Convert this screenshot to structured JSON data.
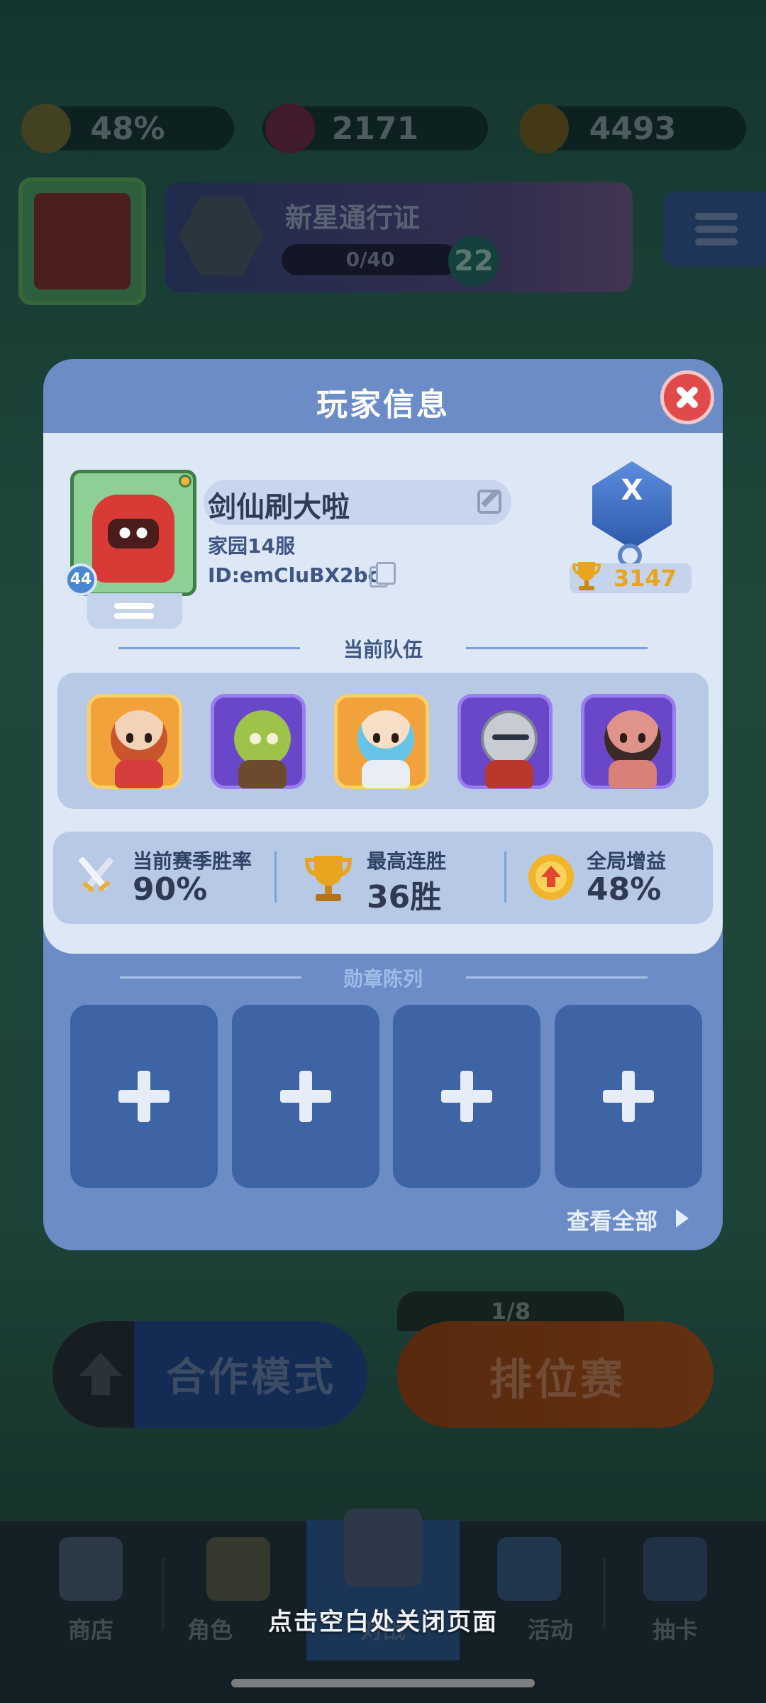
{
  "background": {
    "resources": {
      "boost_percent": "48%",
      "gems": "2171",
      "coins": "4493"
    },
    "pass": {
      "title": "新星通行证",
      "progress": "0/40",
      "level": "22"
    },
    "player_level": "44",
    "coop_mode_label": "合作模式",
    "ranked_label": "排位赛",
    "ranked_counter": "1/8",
    "nav": {
      "shop": "商店",
      "role": "角色",
      "battle": "对战",
      "events": "活动",
      "draw": "抽卡"
    }
  },
  "modal": {
    "title": "玩家信息",
    "player": {
      "name": "剑仙刷大啦",
      "server": "家园14服",
      "id": "ID:emCluBX2bc",
      "level": "44",
      "rank_letter": "X",
      "trophies": "3147"
    },
    "team_heading": "当前队伍",
    "team_heroes": [
      "red-haired-swordsman",
      "goblin-engineer",
      "ice-priestess",
      "armored-knight",
      "orc-brawler"
    ],
    "stats": {
      "winrate_label": "当前赛季胜率",
      "winrate_value": "90%",
      "streak_label": "最高连胜",
      "streak_value": "36胜",
      "boost_label": "全局增益",
      "boost_value": "48%"
    },
    "medal_heading": "勋章陈列",
    "medal_slots": 4,
    "view_all": "查看全部"
  },
  "close_hint": "点击空白处关闭页面",
  "colors": {
    "modal_bg": "#6c8cc7",
    "panel_bg": "#dde7f6",
    "close_red": "#e14a4a",
    "trophy_gold": "#e8a51d",
    "medal_slot": "#3e64a6"
  }
}
